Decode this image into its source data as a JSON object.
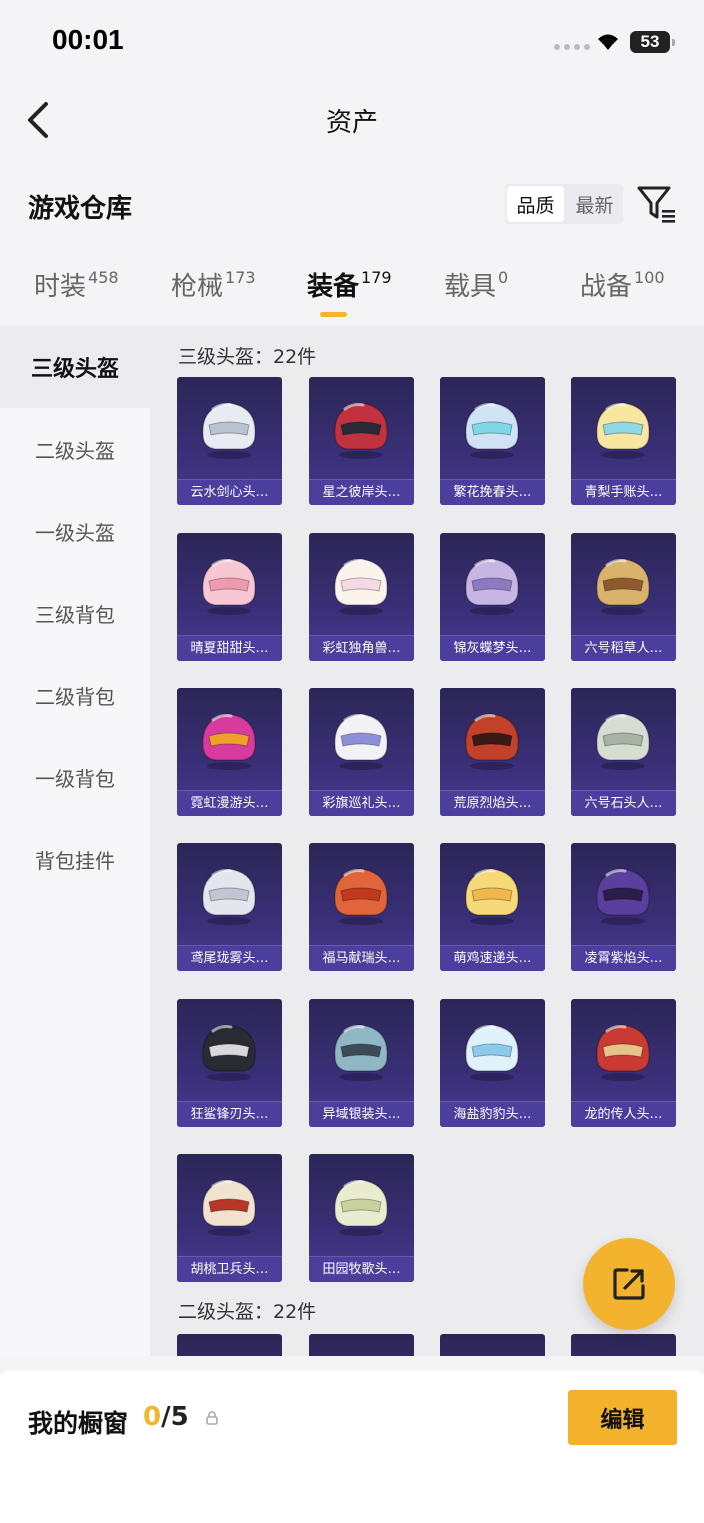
{
  "status_bar": {
    "time": "00:01",
    "battery": "53"
  },
  "nav": {
    "title": "资产"
  },
  "warehouse": {
    "title": "游戏仓库",
    "sort_quality": "品质",
    "sort_latest": "最新"
  },
  "tabs": [
    {
      "label": "时装",
      "count": "458"
    },
    {
      "label": "枪械",
      "count": "173"
    },
    {
      "label": "装备",
      "count": "179"
    },
    {
      "label": "载具",
      "count": "0"
    },
    {
      "label": "战备",
      "count": "100"
    }
  ],
  "sidebar": {
    "items": [
      "三级头盔",
      "二级头盔",
      "一级头盔",
      "三级背包",
      "二级背包",
      "一级背包",
      "背包挂件"
    ]
  },
  "sections": [
    {
      "title": "三级头盔：22件",
      "items": [
        "云水剑心头…",
        "星之彼岸头…",
        "繁花挽春头…",
        "青梨手账头…",
        "晴夏甜甜头…",
        "彩虹独角兽…",
        "锦灰蝶梦头…",
        "六号稻草人…",
        "霓虹漫游头…",
        "彩旗巡礼头…",
        "荒原烈焰头…",
        "六号石头人…",
        "鸢尾珑雾头…",
        "福马献瑞头…",
        "萌鸡速递头…",
        "凌霄紫焰头…",
        "狂鲨锋刃头…",
        "异域银装头…",
        "海盐豹豹头…",
        "龙的传人头…",
        "胡桃卫兵头…",
        "田园牧歌头…"
      ]
    },
    {
      "title": "二级头盔：22件"
    }
  ],
  "showcase": {
    "label": "我的橱窗",
    "current": "0",
    "total": "/5",
    "edit_label": "编辑"
  },
  "colors": {
    "accent": "#f2b22c",
    "card_bg": "#3a2f78",
    "card_label_bg": "#4b3e9d"
  },
  "helmet_palette": [
    [
      "#e8ecf2",
      "#b9c3d0"
    ],
    [
      "#c0323f",
      "#2a2a36"
    ],
    [
      "#cfe3f4",
      "#7fd6e6"
    ],
    [
      "#f7e7a0",
      "#8fd8e8"
    ],
    [
      "#f7c7d3",
      "#f09ab1"
    ],
    [
      "#fbf4ec",
      "#f5d9e5"
    ],
    [
      "#c7b6e3",
      "#8d79c0"
    ],
    [
      "#d9b36b",
      "#8c5a2e"
    ],
    [
      "#d83b9d",
      "#f0a02c"
    ],
    [
      "#f2f2f6",
      "#8d8fd8"
    ],
    [
      "#c2412a",
      "#3a1a18"
    ],
    [
      "#d8ddd4",
      "#a9b3a4"
    ],
    [
      "#e4e6ee",
      "#c2c6d3"
    ],
    [
      "#e0653a",
      "#c2391e"
    ],
    [
      "#f6da78",
      "#f2b74c"
    ],
    [
      "#5b3f9e",
      "#2a1d4c"
    ],
    [
      "#2a2a33",
      "#d9d9dd"
    ],
    [
      "#8fb8c4",
      "#3c4b58"
    ],
    [
      "#dff1fb",
      "#8cc9ea"
    ],
    [
      "#c83a32",
      "#e8c48c"
    ],
    [
      "#f2e2d0",
      "#b83628"
    ],
    [
      "#e9eccf",
      "#c9d29c"
    ]
  ]
}
